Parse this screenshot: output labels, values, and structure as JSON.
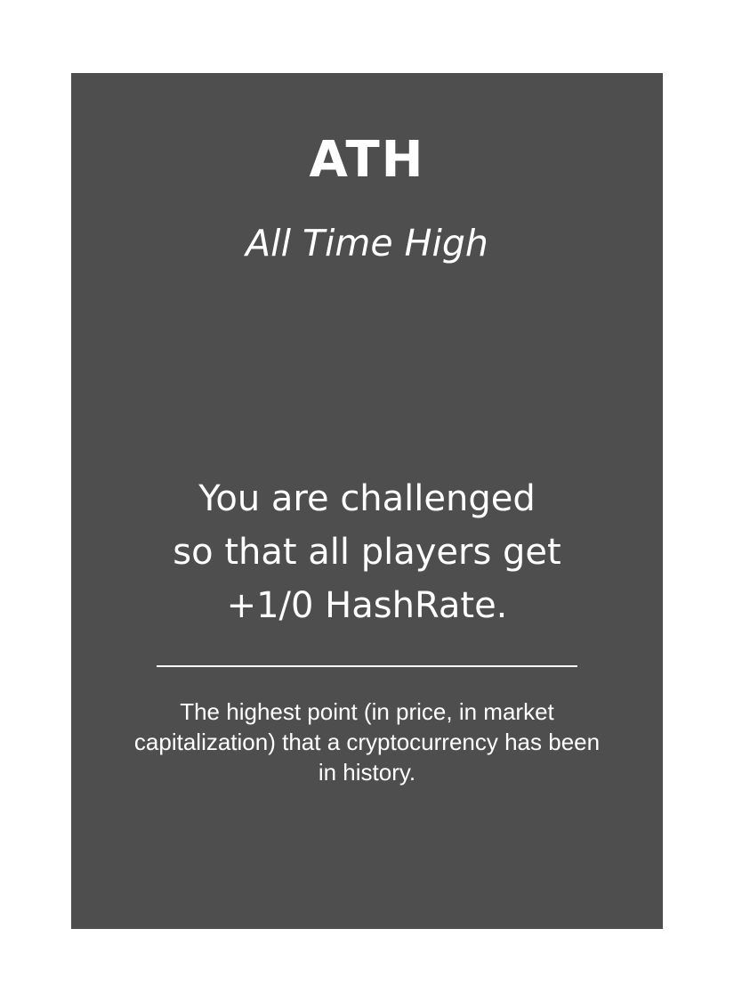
{
  "card": {
    "title": "ATH",
    "subtitle": "All Time High",
    "effect_lines": [
      "You are challenged",
      "so that all players get",
      "+1/0 HashRate."
    ],
    "flavor": "The highest point (in price, in market capitalization) that a cryptocurrency has been in history.",
    "colors": {
      "background": "#4e4e4e",
      "text": "#ffffff",
      "page": "#ffffff"
    }
  }
}
